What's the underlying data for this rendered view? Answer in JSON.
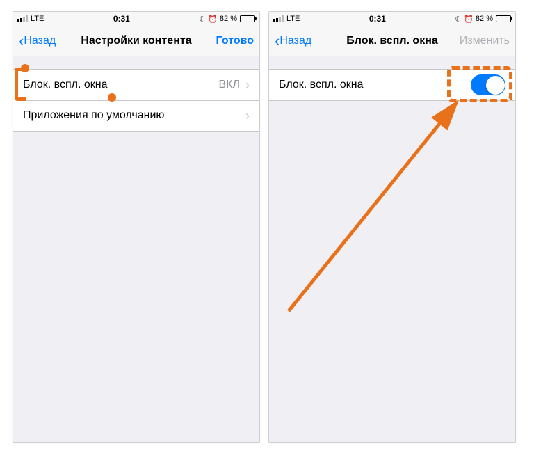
{
  "left": {
    "statusbar": {
      "carrier": "LTE",
      "time": "0:31",
      "battery": "82 %"
    },
    "nav": {
      "back": "Назад",
      "title": "Настройки контента",
      "action": "Готово"
    },
    "rows": [
      {
        "label": "Блок. вспл. окна",
        "value": "ВКЛ"
      },
      {
        "label": "Приложения по умолчанию",
        "value": ""
      }
    ]
  },
  "right": {
    "statusbar": {
      "carrier": "LTE",
      "time": "0:31",
      "battery": "82 %"
    },
    "nav": {
      "back": "Назад",
      "title": "Блок. вспл. окна",
      "action": "Изменить",
      "action_disabled": true
    },
    "rows": [
      {
        "label": "Блок. вспл. окна",
        "toggle": true
      }
    ]
  }
}
